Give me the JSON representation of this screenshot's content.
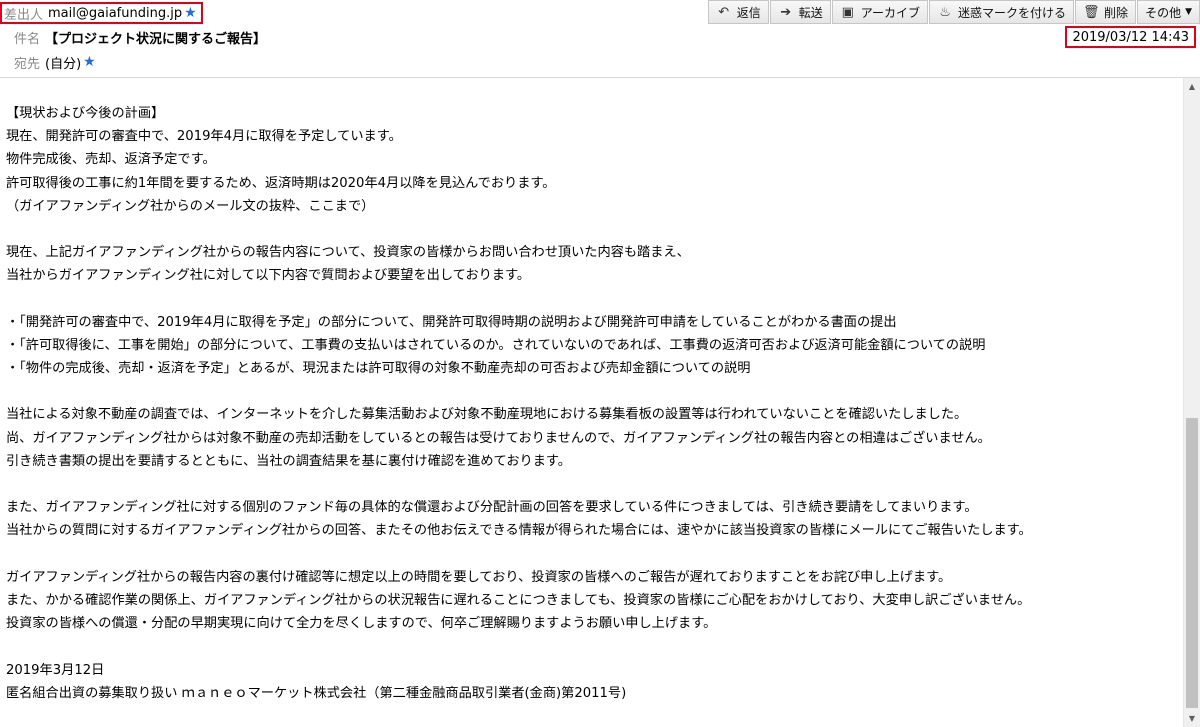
{
  "header": {
    "from_label": "差出人",
    "from_value": "mail@gaiafunding.jp",
    "subject_label": "件名",
    "subject_value": "【プロジェクト状況に関するご報告】",
    "to_label": "宛先",
    "to_value": "(自分)",
    "date": "2019/03/12 14:43"
  },
  "toolbar": {
    "reply": "返信",
    "forward": "転送",
    "archive": "アーカイブ",
    "junk": "迷惑マークを付ける",
    "delete": "削除",
    "other": "その他"
  },
  "icons": {
    "reply": "reply-arrow-icon",
    "forward": "forward-arrow-icon",
    "archive": "archive-box-icon",
    "junk": "flame-icon",
    "delete": "trash-icon",
    "star": "star-icon"
  },
  "body": {
    "lines": [
      "【現状および今後の計画】",
      "現在、開発許可の審査中で、2019年4月に取得を予定しています。",
      "物件完成後、売却、返済予定です。",
      "許可取得後の工事に約1年間を要するため、返済時期は2020年4月以降を見込んでおります。",
      "（ガイアファンディング社からのメール文の抜粋、ここまで）",
      "",
      "現在、上記ガイアファンディング社からの報告内容について、投資家の皆様からお問い合わせ頂いた内容も踏まえ、",
      "当社からガイアファンディング社に対して以下内容で質問および要望を出しております。",
      "",
      "・「開発許可の審査中で、2019年4月に取得を予定」の部分について、開発許可取得時期の説明および開発許可申請をしていることがわかる書面の提出",
      "・「許可取得後に、工事を開始」の部分について、工事費の支払いはされているのか。されていないのであれば、工事費の返済可否および返済可能金額についての説明",
      "・「物件の完成後、売却・返済を予定」とあるが、現況または許可取得の対象不動産売却の可否および売却金額についての説明",
      "",
      "当社による対象不動産の調査では、インターネットを介した募集活動および対象不動産現地における募集看板の設置等は行われていないことを確認いたしました。",
      "尚、ガイアファンディング社からは対象不動産の売却活動をしているとの報告は受けておりませんので、ガイアファンディング社の報告内容との相違はございません。",
      "引き続き書類の提出を要請するとともに、当社の調査結果を基に裏付け確認を進めております。",
      "",
      "また、ガイアファンディング社に対する個別のファンド毎の具体的な償還および分配計画の回答を要求している件につきましては、引き続き要請をしてまいります。",
      "当社からの質問に対するガイアファンディング社からの回答、またその他お伝えできる情報が得られた場合には、速やかに該当投資家の皆様にメールにてご報告いたします。",
      "",
      "ガイアファンディング社からの報告内容の裏付け確認等に想定以上の時間を要しており、投資家の皆様へのご報告が遅れておりますことをお詫び申し上げます。",
      "また、かかる確認作業の関係上、ガイアファンディング社からの状況報告に遅れることにつきましても、投資家の皆様にご心配をおかけしており、大変申し訳ございません。",
      "投資家の皆様への償還・分配の早期実現に向けて全力を尽くしますので、何卒ご理解賜りますようお願い申し上げます。",
      "",
      "2019年3月12日",
      "匿名組合出資の募集取り扱い ｍａｎｅｏマーケット株式会社（第二種金融商品取引業者(金商)第2011号)"
    ]
  }
}
